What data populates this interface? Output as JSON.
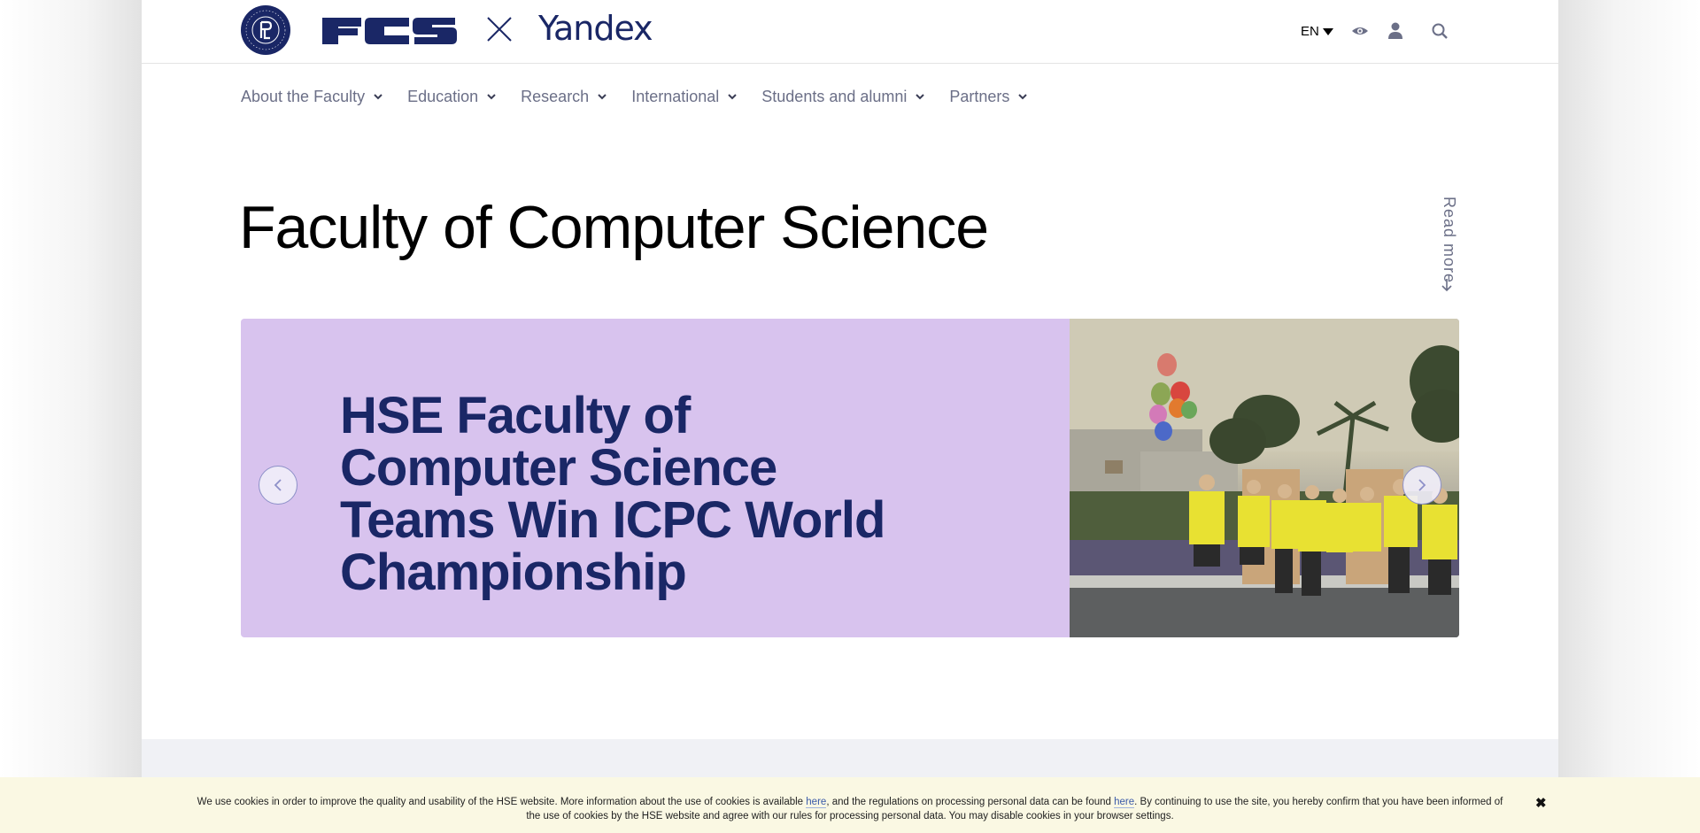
{
  "header": {
    "logos": {
      "university": "HSE University",
      "university_ring_text": "HSE UNIVERSITY · EST 1992",
      "faculty": "FCS",
      "separator": "×",
      "partner": "Yandex"
    },
    "language": "EN",
    "icons": [
      "eye-icon",
      "user-icon",
      "search-icon"
    ]
  },
  "nav": {
    "items": [
      {
        "label": "About the Faculty"
      },
      {
        "label": "Education"
      },
      {
        "label": "Research"
      },
      {
        "label": "International"
      },
      {
        "label": "Students and alumni"
      },
      {
        "label": "Partners"
      }
    ]
  },
  "main": {
    "title": "Faculty of Computer Science",
    "read_more": "Read more"
  },
  "slider": {
    "headline": "HSE Faculty of Computer Science Teams Win ICPC World Championship",
    "image_alt": "Students in yellow t-shirts holding balloons at ICPC",
    "background_color": "#d8c3ee",
    "headline_color": "#1a2766"
  },
  "cookie": {
    "text_1": "We use cookies in order to improve the quality and usability of the HSE website. More information about the use of cookies is available ",
    "link_1": "here",
    "text_2": ", and the regulations on processing personal data can be found ",
    "link_2": "here",
    "text_3": ". By continuing to use the site, you hereby confirm that you have been informed of the use of cookies by the HSE website and agree with our rules for processing personal data. You may disable cookies in your browser settings.",
    "close": "✖"
  },
  "colors": {
    "brand": "#1a2766",
    "nav_text": "#6b6f87",
    "cookie_bg": "#faf8e3"
  }
}
